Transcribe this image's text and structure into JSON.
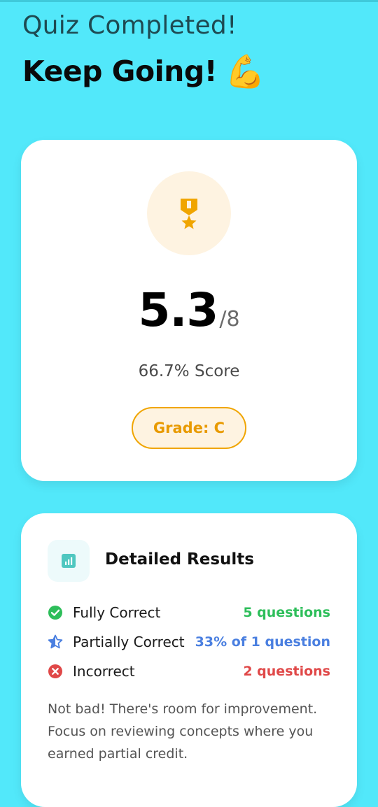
{
  "header": {
    "title": "Quiz Completed!",
    "subtitle": "Keep Going!",
    "subtitle_emoji": "💪"
  },
  "score_card": {
    "icon": "medal-icon",
    "score": "5.3",
    "total": "/8",
    "percent_label": "66.7% Score",
    "grade_label": "Grade: C",
    "accent_color": "#F0A500"
  },
  "results": {
    "icon": "bar-chart-icon",
    "title": "Detailed Results",
    "rows": [
      {
        "icon": "check-circle-icon",
        "label": "Fully Correct",
        "value": "5 questions",
        "color": "#2DBE5A"
      },
      {
        "icon": "star-outline-icon",
        "label": "Partially Correct",
        "value": "33% of 1 question",
        "color": "#4A7FE0"
      },
      {
        "icon": "x-circle-icon",
        "label": "Incorrect",
        "value": "2 questions",
        "color": "#E04848"
      }
    ],
    "message": "Not bad! There's room for improvement. Focus on reviewing concepts where you earned partial credit."
  },
  "colors": {
    "background": "#52E8FA",
    "card": "#FFFFFF"
  }
}
